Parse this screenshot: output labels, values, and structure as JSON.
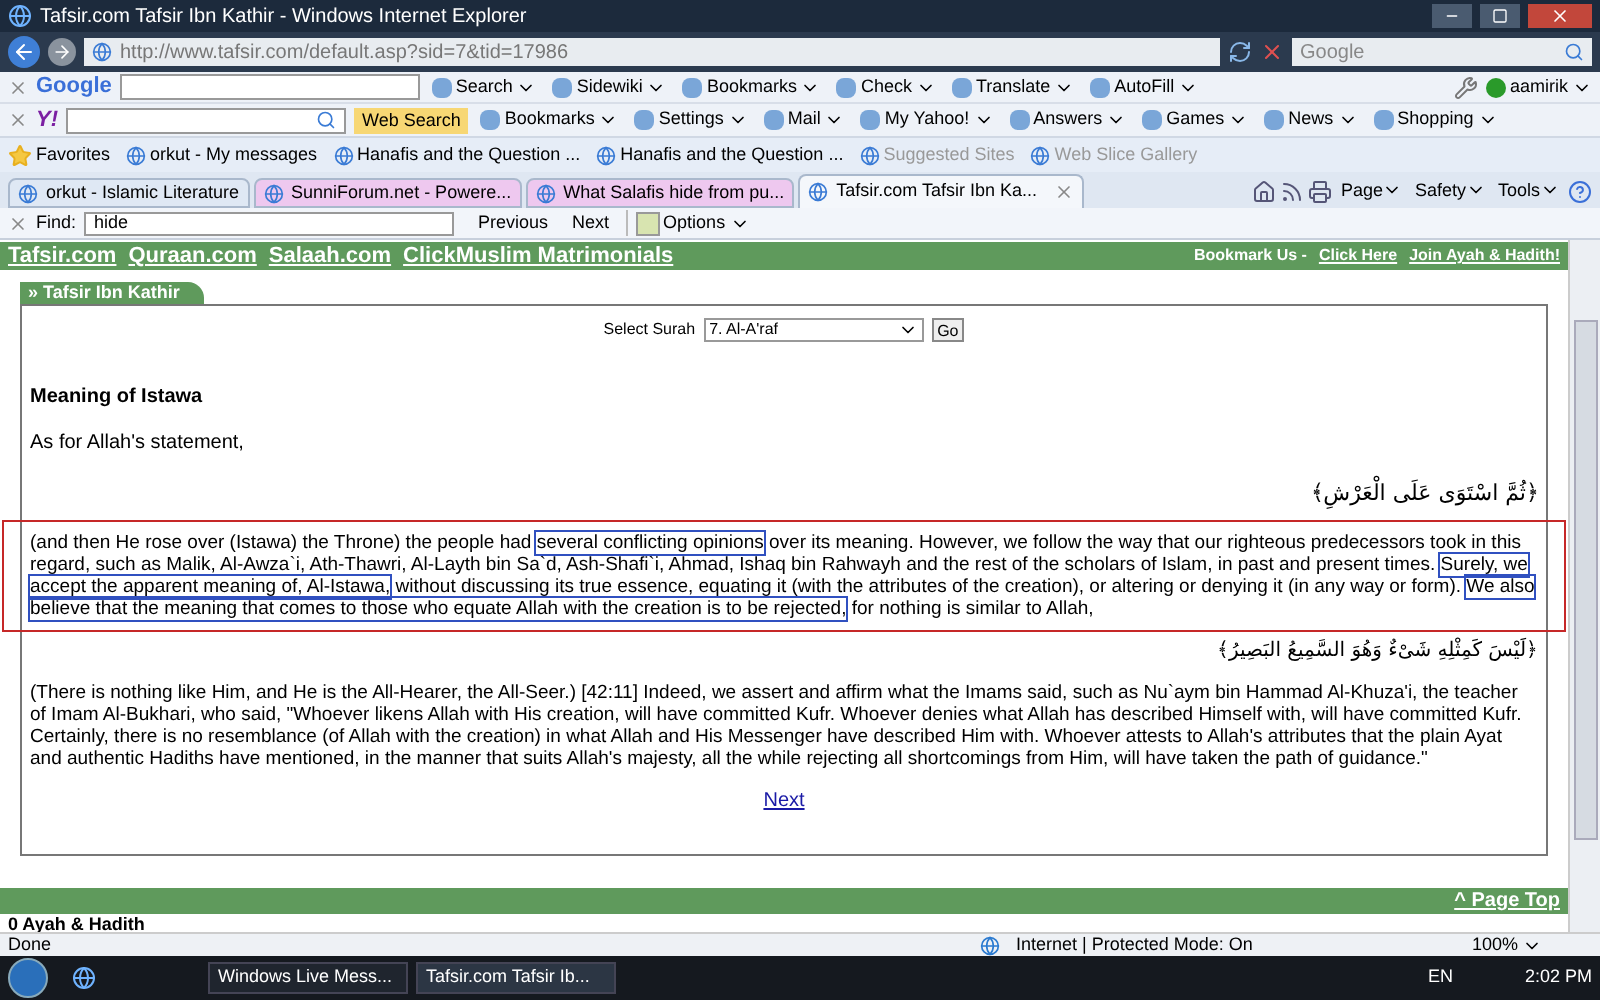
{
  "window": {
    "title": "Tafsir.com Tafsir Ibn Kathir - Windows Internet Explorer"
  },
  "address_bar": {
    "url": "http://www.tafsir.com/default.asp?sid=7&tid=17986",
    "search_placeholder": "Google"
  },
  "google_toolbar": {
    "logo": "Google",
    "items": [
      "Search",
      "Sidewiki",
      "Bookmarks",
      "Check",
      "Translate",
      "AutoFill"
    ],
    "account": "aamirik"
  },
  "yahoo_toolbar": {
    "logo": "Y!",
    "web_search": "Web Search",
    "items": [
      "Bookmarks",
      "Settings",
      "Mail",
      "My Yahoo!",
      "Answers",
      "Games",
      "News",
      "Shopping"
    ]
  },
  "favorites_bar": {
    "label": "Favorites",
    "items": [
      {
        "label": "orkut - My messages",
        "dimmed": false
      },
      {
        "label": "Hanafis and the Question ...",
        "dimmed": false
      },
      {
        "label": "Hanafis and the Question ...",
        "dimmed": false
      },
      {
        "label": "Suggested Sites",
        "dimmed": true
      },
      {
        "label": "Web Slice Gallery",
        "dimmed": true
      }
    ]
  },
  "tabs": [
    {
      "label": "orkut - Islamic Literature",
      "selected": false,
      "color": "#dfe8f4"
    },
    {
      "label": "SunniForum.net - Powere...",
      "selected": false,
      "color": "#eec8ef"
    },
    {
      "label": "What Salafis hide from pu...",
      "selected": false,
      "color": "#eec8ef"
    },
    {
      "label": "Tafsir.com Tafsir Ibn Ka...",
      "selected": true,
      "color": "#f4f7fb"
    }
  ],
  "command_bar": [
    "Page",
    "Safety",
    "Tools"
  ],
  "find_bar": {
    "label": "Find:",
    "value": "hide",
    "previous": "Previous",
    "next": "Next",
    "options": "Options"
  },
  "site_nav": {
    "links": [
      "Tafsir.com",
      "Quraan.com",
      "Salaah.com",
      "ClickMuslim Matrimonials"
    ],
    "bookmark_text": "Bookmark Us -",
    "bookmark_links": [
      "Click Here",
      "Join Ayah & Hadith!"
    ]
  },
  "panel": {
    "tab": "» Tafsir Ibn Kathir",
    "select_label": "Select Surah",
    "select_value": "7. Al-A'raf",
    "go": "Go",
    "heading": "Meaning of Istawa",
    "intro": "As for Allah's statement,",
    "ayah_1": "﴿ثُمَّ اسْتَوَى عَلَى الْعَرْشِ﴾",
    "paragraph_1": [
      {
        "text": "(and then He rose over (Istawa) the Throne) the people had ",
        "highlighted": false
      },
      {
        "text": "several conflicting opinions",
        "highlighted": true
      },
      {
        "text": " over its meaning. However, we follow the way that our righteous predecessors took in this regard, such as Malik, Al-Awza`i, Ath-Thawri, Al-Layth bin Sa`d, Ash-Shafi`i, Ahmad, Ishaq bin Rahwayh and the rest of the scholars of Islam, in past and present times. ",
        "highlighted": false
      },
      {
        "text": "Surely, we accept the apparent meaning of, Al-Istawa,",
        "highlighted": true
      },
      {
        "text": " without discussing its true essence, equating it (with the attributes of the creation), or altering or denying it (in any way or form). ",
        "highlighted": false
      },
      {
        "text": "We also believe that the meaning that comes to those who equate Allah with the creation is to be rejected,",
        "highlighted": true
      },
      {
        "text": " for nothing is similar to Allah,",
        "highlighted": false
      }
    ],
    "paragraph_1_framed": true,
    "ayah_2": "﴿لَيْسَ كَمِثْلِهِ شَىْءٌ وَهُوَ السَّمِيعُ البَصِيرُ﴾",
    "paragraph_2": "(There is nothing like Him, and He is the All-Hearer, the All-Seer.) [42:11] Indeed, we assert and affirm what the Imams said, such as Nu`aym bin Hammad Al-Khuza'i, the teacher of Imam Al-Bukhari, who said, \"Whoever likens Allah with His creation, will have committed Kufr. Whoever denies what Allah has described Himself with, will have committed Kufr. Certainly, there is no resemblance (of Allah with the creation) in what Allah and His Messenger have described Him with. Whoever attests to Allah's attributes that the plain Ayat and authentic Hadiths have mentioned, in the manner that suits Allah's majesty, all the while rejecting all shortcomings from Him, will have taken the path of guidance.\"",
    "next": "Next"
  },
  "footer_bar": {
    "link": "^ Page Top",
    "below": "0 Ayah & Hadith"
  },
  "status_bar": {
    "text": "Done",
    "zone": "Internet | Protected Mode: On",
    "zoom": "100%"
  },
  "taskbar": {
    "items": [
      {
        "label": "Windows Live Mess...",
        "selected": false
      },
      {
        "label": "Tafsir.com Tafsir Ib...",
        "selected": true
      }
    ],
    "language": "EN",
    "time": "2:02 PM"
  }
}
